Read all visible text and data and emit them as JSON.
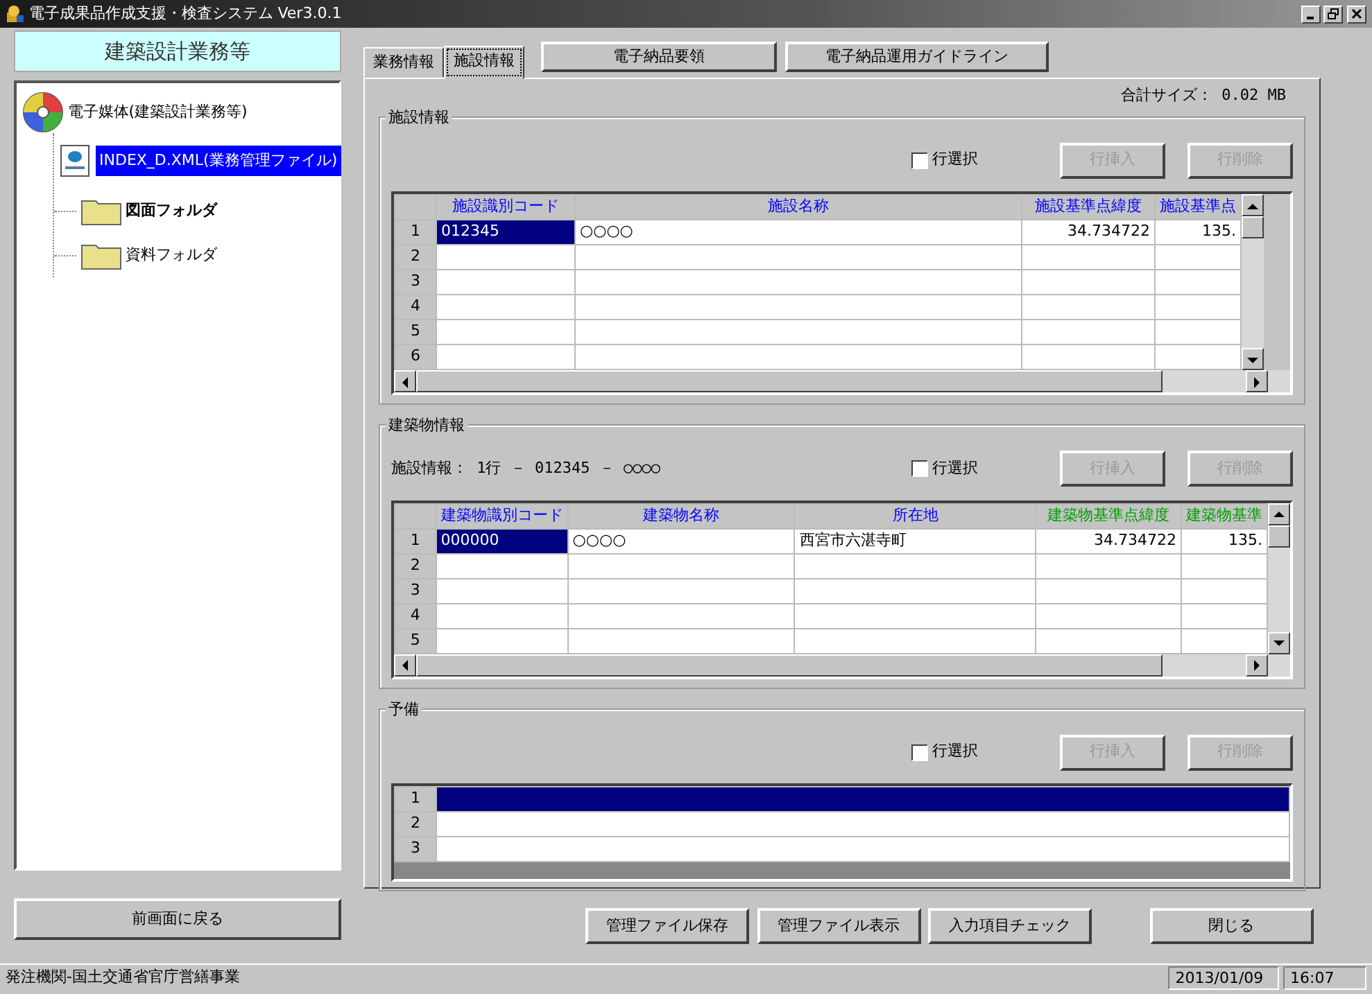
{
  "window": {
    "title": "電子成果品作成支援・検査システム Ver3.0.1"
  },
  "sidebar": {
    "header": "建築設計業務等",
    "tree": {
      "label": "電子媒体(建築設計業務等)",
      "kind": "disc",
      "children": [
        {
          "label": "INDEX_D.XML(業務管理ファイル)",
          "kind": "file",
          "selected": true,
          "bold": false
        },
        {
          "label": "図面フォルダ",
          "kind": "folder",
          "selected": false,
          "bold": true
        },
        {
          "label": "資料フォルダ",
          "kind": "folder",
          "selected": false,
          "bold": false
        }
      ]
    },
    "back_button": "前画面に戻る"
  },
  "tabs": [
    {
      "label": "業務情報",
      "selected": false
    },
    {
      "label": "施設情報",
      "selected": true
    }
  ],
  "guide_buttons": [
    "電子納品要領",
    "電子納品運用ガイドライン"
  ],
  "total_size": "合計サイズ： 0.02 MB",
  "sections": [
    {
      "title": "施設情報",
      "row_select": {
        "label": "行選択",
        "checked": false
      },
      "buttons": [
        {
          "label": "行挿入",
          "disabled": true
        },
        {
          "label": "行削除",
          "disabled": true
        }
      ],
      "table": {
        "columns": [
          {
            "label": "施設識別コード",
            "color": "#0000ff"
          },
          {
            "label": "施設名称",
            "color": "#0000ff"
          },
          {
            "label": "施設基準点緯度",
            "color": "#0000ff"
          },
          {
            "label": "施設基準点",
            "color": "#0000ff"
          }
        ],
        "rows": [
          {
            "number": "1",
            "cells": [
              {
                "text": "012345",
                "selected": true
              },
              {
                "text": "○○○○",
                "selected": false
              },
              {
                "text": "34.734722",
                "selected": false
              },
              {
                "text": "135.",
                "selected": false
              }
            ]
          },
          {
            "number": "2"
          },
          {
            "number": "3"
          },
          {
            "number": "4"
          },
          {
            "number": "5"
          },
          {
            "number": "6"
          }
        ]
      }
    },
    {
      "title": "建築物情報",
      "info": "施設情報： 1行 － 012345 － ○○○○",
      "row_select": {
        "label": "行選択",
        "checked": false
      },
      "buttons": [
        {
          "label": "行挿入",
          "disabled": true
        },
        {
          "label": "行削除",
          "disabled": true
        }
      ],
      "table": {
        "columns": [
          {
            "label": "建築物識別コード",
            "color": "#0000ff"
          },
          {
            "label": "建築物名称",
            "color": "#0000ff"
          },
          {
            "label": "所在地",
            "color": "#0000ff"
          },
          {
            "label": "建築物基準点緯度",
            "color": "#00a000"
          },
          {
            "label": "建築物基準",
            "color": "#00a000"
          }
        ],
        "rows": [
          {
            "number": "1",
            "cells": [
              {
                "text": "000000",
                "selected": true
              },
              {
                "text": "○○○○",
                "selected": false
              },
              {
                "text": "西宮市六湛寺町",
                "selected": false
              },
              {
                "text": "34.734722",
                "selected": false
              },
              {
                "text": "135.",
                "selected": false
              }
            ]
          },
          {
            "number": "2"
          },
          {
            "number": "3"
          },
          {
            "number": "4"
          },
          {
            "number": "5"
          }
        ]
      }
    },
    {
      "title": "予備",
      "row_select": {
        "label": "行選択",
        "checked": false
      },
      "buttons": [
        {
          "label": "行挿入",
          "disabled": true
        },
        {
          "label": "行削除",
          "disabled": true
        }
      ],
      "table": {
        "rows": [
          {
            "number": "1",
            "selected": true
          },
          {
            "number": "2",
            "selected": false
          },
          {
            "number": "3",
            "selected": false
          }
        ]
      }
    }
  ],
  "action_buttons": [
    "管理ファイル保存",
    "管理ファイル表示",
    "入力項目チェック"
  ],
  "close_button": "閉じる",
  "status_bar": {
    "text": "発注機関-国土交通省官庁営繕事業",
    "date": "2013/01/09",
    "time": "16:07"
  }
}
